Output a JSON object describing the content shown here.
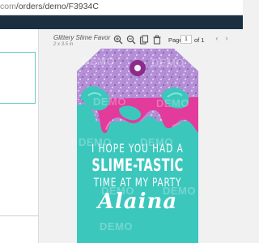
{
  "browser": {
    "url_host": "com",
    "url_path": "/orders/demo/F3934C"
  },
  "design": {
    "title": "Glittery Slime Favor",
    "size": "2 x 3.5 in"
  },
  "pagination": {
    "page_label": "Page",
    "page_value": "1",
    "of_label": "of 1"
  },
  "tag": {
    "line1": "I HOPE YOU HAD A",
    "line2": "SLIME-TASTIC",
    "line3": "TIME AT MY PARTY",
    "name": "Alaina",
    "watermark": "DEMO",
    "colors": {
      "teal": "#3cc7bd",
      "glitter": "#b48fd6",
      "pink": "#e23b9c",
      "hole": "#8b2b8a"
    }
  },
  "icons": {
    "zoom_in": "zoom-in-icon",
    "zoom_out": "zoom-out-icon",
    "copy": "copy-icon",
    "delete": "trash-icon"
  }
}
